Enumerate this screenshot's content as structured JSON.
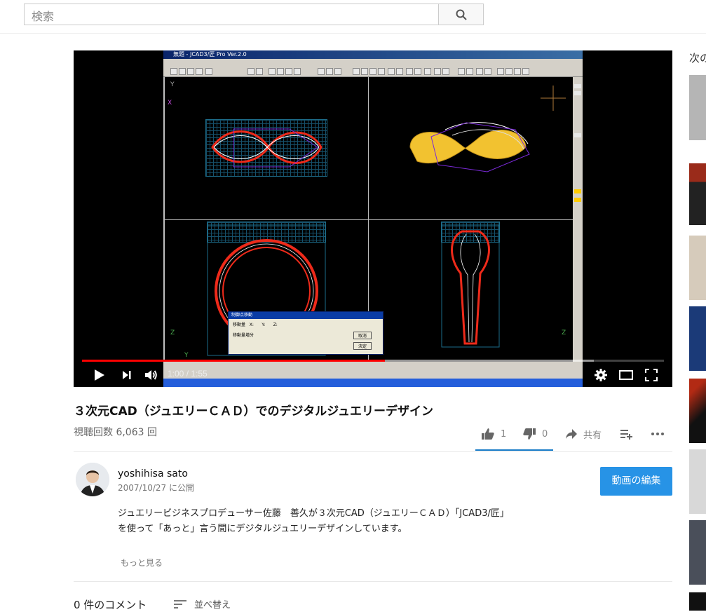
{
  "header": {
    "search_placeholder": "検索"
  },
  "player": {
    "time_display": "1:00 / 1:55",
    "progress_fraction": 0.52,
    "loaded_fraction": 0.88,
    "cad": {
      "window_title": "無題 - JCAD3/匠 Pro Ver.2.0",
      "dialog_title": "制御点移動",
      "dialog_labels": [
        "移動量",
        "X:",
        "Y:",
        "Z:",
        "移動量増分"
      ],
      "dialog_buttons": [
        "取消",
        "決定"
      ]
    }
  },
  "video": {
    "title": "３次元CAD（ジュエリーＣＡＤ）でのデジタルジュエリーデザイン",
    "views": "視聴回数 6,063 回",
    "likes": "1",
    "dislikes": "0",
    "share_label": "共有"
  },
  "channel": {
    "name": "yoshihisa sato",
    "published": "2007/10/27 に公開",
    "edit_button": "動画の編集"
  },
  "description": {
    "line1": "ジュエリービジネスプロデューサー佐藤　善久が３次元CAD（ジュエリーＣＡＤ）「JCAD3/匠」",
    "line2": "を使って「あっと」言う間にデジタルジュエリーデザインしています。",
    "show_more": "もっと見る"
  },
  "comments": {
    "count_label": "0 件のコメント",
    "sort_label": "並べ替え"
  },
  "sidebar": {
    "next_label": "次の"
  },
  "colors": {
    "accent_blue": "#2793e6",
    "progress_red": "#ff0000",
    "tab_underline": "#167ac6"
  }
}
